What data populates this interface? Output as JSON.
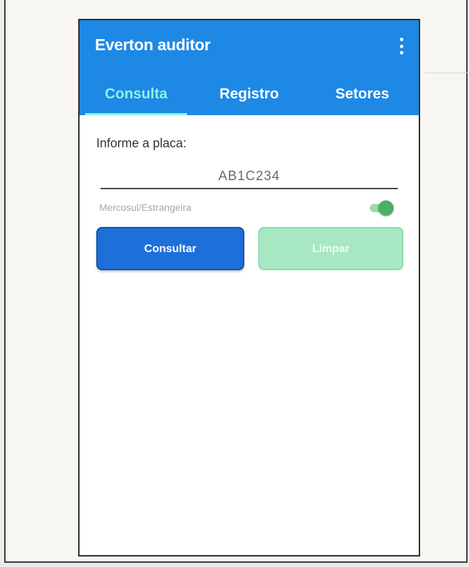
{
  "app": {
    "title": "Everton auditor"
  },
  "tabs": [
    {
      "label": "Consulta",
      "active": true
    },
    {
      "label": "Registro",
      "active": false
    },
    {
      "label": "Setores",
      "active": false
    }
  ],
  "form": {
    "plate_label": "Informe a placa:",
    "plate_value": "AB1C234",
    "switch_label": "Mercosul/Estrangeira",
    "switch_on": true
  },
  "buttons": {
    "consultar": "Consultar",
    "limpar": "Limpar"
  },
  "icons": {
    "menu": "more-vert-icon"
  },
  "colors": {
    "appbar": "#1e88e5",
    "active_tab": "#8ff2e8",
    "primary_button": "#1e6fd9",
    "secondary_button": "#a6e8c2",
    "switch_on": "#4caf63"
  }
}
